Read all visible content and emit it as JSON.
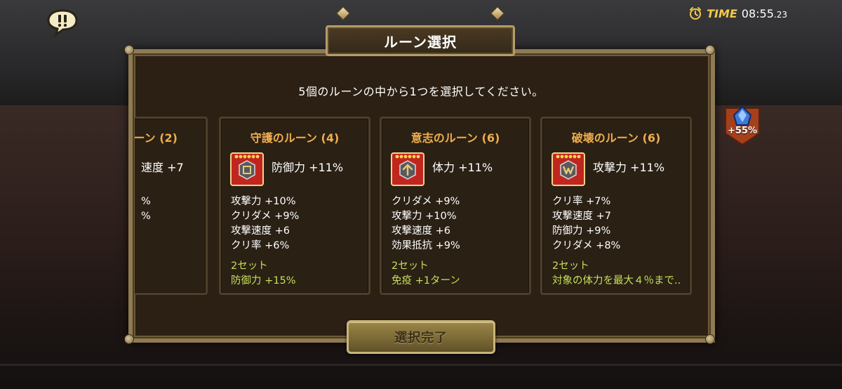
{
  "header": {
    "timer_label": "TIME",
    "timer_value": "08:55",
    "timer_fraction": ".23"
  },
  "side_badge": {
    "text": "+55%"
  },
  "dialog": {
    "title": "ルーン選択",
    "subtitle": "5個のルーンの中から1つを選択してください。",
    "confirm_label": "選択完了"
  },
  "cards": [
    {
      "title": "ーン (2)",
      "main_stat": "速度 +7",
      "sub_stats": [
        "",
        "",
        "%",
        "%"
      ],
      "set_label": "",
      "set_effect": ""
    },
    {
      "title": "守護のルーン (4)",
      "main_stat": "防御力 +11%",
      "rune_symbol": "guard",
      "sub_stats": [
        "攻撃力 +10%",
        "クリダメ +9%",
        "攻撃速度 +6",
        "クリ率 +6%"
      ],
      "set_label": "2セット",
      "set_effect": "防御力 +15%"
    },
    {
      "title": "意志のルーン (6)",
      "main_stat": "体力 +11%",
      "rune_symbol": "will",
      "sub_stats": [
        "クリダメ +9%",
        "攻撃力 +10%",
        "攻撃速度 +6",
        "効果抵抗 +9%"
      ],
      "set_label": "2セット",
      "set_effect": "免疫 +1ターン"
    },
    {
      "title": "破壊のルーン (6)",
      "main_stat": "攻撃力 +11%",
      "rune_symbol": "destroy",
      "sub_stats": [
        "クリ率 +7%",
        "攻撃速度 +7",
        "防御力 +9%",
        "クリダメ +8%"
      ],
      "set_label": "2セット",
      "set_effect": "対象の体力を最大４％まで.."
    }
  ],
  "colors": {
    "card_title": "#f0ad4e",
    "set_text": "#c7df5b",
    "timer_label": "#f2c94c",
    "panel_border": "#8f7a52"
  },
  "icons": [
    "chat-alert-icon",
    "clock-icon",
    "blue-gem-icon",
    "rune-icon"
  ]
}
